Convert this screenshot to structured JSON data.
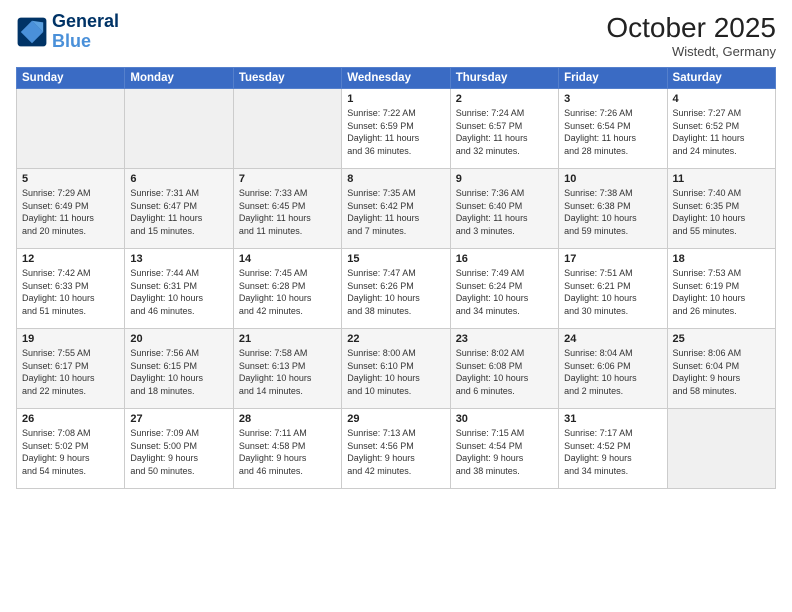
{
  "header": {
    "logo_line1": "General",
    "logo_line2": "Blue",
    "month": "October 2025",
    "location": "Wistedt, Germany"
  },
  "days_of_week": [
    "Sunday",
    "Monday",
    "Tuesday",
    "Wednesday",
    "Thursday",
    "Friday",
    "Saturday"
  ],
  "weeks": [
    [
      {
        "day": "",
        "info": ""
      },
      {
        "day": "",
        "info": ""
      },
      {
        "day": "",
        "info": ""
      },
      {
        "day": "1",
        "info": "Sunrise: 7:22 AM\nSunset: 6:59 PM\nDaylight: 11 hours\nand 36 minutes."
      },
      {
        "day": "2",
        "info": "Sunrise: 7:24 AM\nSunset: 6:57 PM\nDaylight: 11 hours\nand 32 minutes."
      },
      {
        "day": "3",
        "info": "Sunrise: 7:26 AM\nSunset: 6:54 PM\nDaylight: 11 hours\nand 28 minutes."
      },
      {
        "day": "4",
        "info": "Sunrise: 7:27 AM\nSunset: 6:52 PM\nDaylight: 11 hours\nand 24 minutes."
      }
    ],
    [
      {
        "day": "5",
        "info": "Sunrise: 7:29 AM\nSunset: 6:49 PM\nDaylight: 11 hours\nand 20 minutes."
      },
      {
        "day": "6",
        "info": "Sunrise: 7:31 AM\nSunset: 6:47 PM\nDaylight: 11 hours\nand 15 minutes."
      },
      {
        "day": "7",
        "info": "Sunrise: 7:33 AM\nSunset: 6:45 PM\nDaylight: 11 hours\nand 11 minutes."
      },
      {
        "day": "8",
        "info": "Sunrise: 7:35 AM\nSunset: 6:42 PM\nDaylight: 11 hours\nand 7 minutes."
      },
      {
        "day": "9",
        "info": "Sunrise: 7:36 AM\nSunset: 6:40 PM\nDaylight: 11 hours\nand 3 minutes."
      },
      {
        "day": "10",
        "info": "Sunrise: 7:38 AM\nSunset: 6:38 PM\nDaylight: 10 hours\nand 59 minutes."
      },
      {
        "day": "11",
        "info": "Sunrise: 7:40 AM\nSunset: 6:35 PM\nDaylight: 10 hours\nand 55 minutes."
      }
    ],
    [
      {
        "day": "12",
        "info": "Sunrise: 7:42 AM\nSunset: 6:33 PM\nDaylight: 10 hours\nand 51 minutes."
      },
      {
        "day": "13",
        "info": "Sunrise: 7:44 AM\nSunset: 6:31 PM\nDaylight: 10 hours\nand 46 minutes."
      },
      {
        "day": "14",
        "info": "Sunrise: 7:45 AM\nSunset: 6:28 PM\nDaylight: 10 hours\nand 42 minutes."
      },
      {
        "day": "15",
        "info": "Sunrise: 7:47 AM\nSunset: 6:26 PM\nDaylight: 10 hours\nand 38 minutes."
      },
      {
        "day": "16",
        "info": "Sunrise: 7:49 AM\nSunset: 6:24 PM\nDaylight: 10 hours\nand 34 minutes."
      },
      {
        "day": "17",
        "info": "Sunrise: 7:51 AM\nSunset: 6:21 PM\nDaylight: 10 hours\nand 30 minutes."
      },
      {
        "day": "18",
        "info": "Sunrise: 7:53 AM\nSunset: 6:19 PM\nDaylight: 10 hours\nand 26 minutes."
      }
    ],
    [
      {
        "day": "19",
        "info": "Sunrise: 7:55 AM\nSunset: 6:17 PM\nDaylight: 10 hours\nand 22 minutes."
      },
      {
        "day": "20",
        "info": "Sunrise: 7:56 AM\nSunset: 6:15 PM\nDaylight: 10 hours\nand 18 minutes."
      },
      {
        "day": "21",
        "info": "Sunrise: 7:58 AM\nSunset: 6:13 PM\nDaylight: 10 hours\nand 14 minutes."
      },
      {
        "day": "22",
        "info": "Sunrise: 8:00 AM\nSunset: 6:10 PM\nDaylight: 10 hours\nand 10 minutes."
      },
      {
        "day": "23",
        "info": "Sunrise: 8:02 AM\nSunset: 6:08 PM\nDaylight: 10 hours\nand 6 minutes."
      },
      {
        "day": "24",
        "info": "Sunrise: 8:04 AM\nSunset: 6:06 PM\nDaylight: 10 hours\nand 2 minutes."
      },
      {
        "day": "25",
        "info": "Sunrise: 8:06 AM\nSunset: 6:04 PM\nDaylight: 9 hours\nand 58 minutes."
      }
    ],
    [
      {
        "day": "26",
        "info": "Sunrise: 7:08 AM\nSunset: 5:02 PM\nDaylight: 9 hours\nand 54 minutes."
      },
      {
        "day": "27",
        "info": "Sunrise: 7:09 AM\nSunset: 5:00 PM\nDaylight: 9 hours\nand 50 minutes."
      },
      {
        "day": "28",
        "info": "Sunrise: 7:11 AM\nSunset: 4:58 PM\nDaylight: 9 hours\nand 46 minutes."
      },
      {
        "day": "29",
        "info": "Sunrise: 7:13 AM\nSunset: 4:56 PM\nDaylight: 9 hours\nand 42 minutes."
      },
      {
        "day": "30",
        "info": "Sunrise: 7:15 AM\nSunset: 4:54 PM\nDaylight: 9 hours\nand 38 minutes."
      },
      {
        "day": "31",
        "info": "Sunrise: 7:17 AM\nSunset: 4:52 PM\nDaylight: 9 hours\nand 34 minutes."
      },
      {
        "day": "",
        "info": ""
      }
    ]
  ]
}
